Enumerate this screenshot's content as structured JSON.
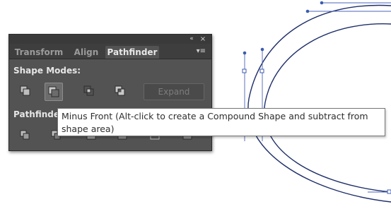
{
  "panel": {
    "collapse_glyph": "«",
    "close_glyph": "×",
    "menu_glyph": "▾≡",
    "tabs": [
      {
        "label": "Transform",
        "active": false
      },
      {
        "label": "Align",
        "active": false
      },
      {
        "label": "Pathfinder",
        "active": true
      }
    ],
    "shape_modes_label": "Shape Modes:",
    "shape_modes": [
      {
        "name": "unite",
        "icon": "unite-icon"
      },
      {
        "name": "minus-front",
        "icon": "minus-front-icon",
        "hovered": true
      },
      {
        "name": "intersect",
        "icon": "intersect-icon"
      },
      {
        "name": "exclude",
        "icon": "exclude-icon"
      }
    ],
    "expand_label": "Expand",
    "pathfinders_label": "Pathfinders:",
    "pathfinders": [
      {
        "name": "divide",
        "icon": "divide-icon"
      },
      {
        "name": "trim",
        "icon": "trim-icon"
      },
      {
        "name": "merge",
        "icon": "merge-icon"
      },
      {
        "name": "crop",
        "icon": "crop-icon"
      },
      {
        "name": "outline",
        "icon": "outline-icon"
      },
      {
        "name": "minus-back",
        "icon": "minus-back-icon"
      }
    ]
  },
  "tooltip": {
    "text": "Minus Front (Alt-click to create a Compound Shape and subtract from shape area)"
  },
  "colors": {
    "panel_bg": "#535353",
    "tab_bar_bg": "#3e3e3e",
    "path_stroke": "#1f2f6b",
    "anchor_blue": "#3c5bb0"
  }
}
